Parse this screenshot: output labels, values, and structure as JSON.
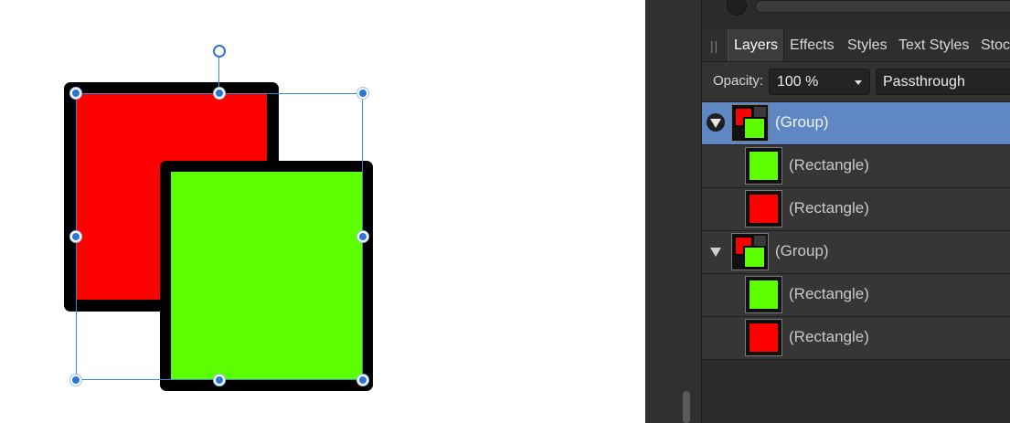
{
  "canvas": {
    "shapes": [
      {
        "id": "back-rectangle",
        "fill": "#ff0000",
        "stroke": "#000000"
      },
      {
        "id": "front-rectangle",
        "fill": "#5cff00",
        "stroke": "#000000"
      }
    ],
    "selection_color": "#2c74d8"
  },
  "panel": {
    "tabs": [
      {
        "label": "Layers",
        "active": true
      },
      {
        "label": "Effects",
        "active": false
      },
      {
        "label": "Styles",
        "active": false
      },
      {
        "label": "Text Styles",
        "active": false
      },
      {
        "label": "Stock",
        "active": false
      }
    ],
    "opacity": {
      "label": "Opacity:",
      "value": "100 %"
    },
    "blend_mode": {
      "value": "Passthrough"
    },
    "layers": [
      {
        "name": "(Group)",
        "type": "group",
        "selected": true
      },
      {
        "name": "(Rectangle)",
        "type": "rectangle",
        "fill": "#5cff00"
      },
      {
        "name": "(Rectangle)",
        "type": "rectangle",
        "fill": "#ff0000"
      },
      {
        "name": "(Group)",
        "type": "group",
        "selected": false
      },
      {
        "name": "(Rectangle)",
        "type": "rectangle",
        "fill": "#5cff00"
      },
      {
        "name": "(Rectangle)",
        "type": "rectangle",
        "fill": "#ff0000"
      }
    ],
    "selected_row_color": "#5e87c4"
  }
}
